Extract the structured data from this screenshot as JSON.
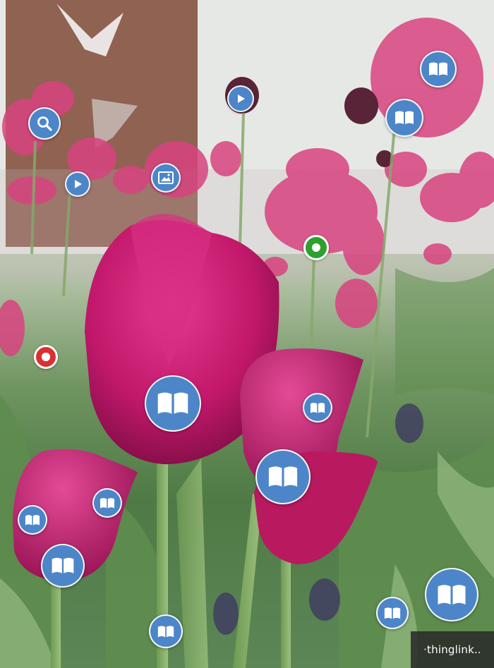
{
  "brand": {
    "label": "·thinglink.."
  },
  "colors": {
    "tag_blue": "#4d86c8",
    "status_green": "#2ea02e",
    "status_red": "#d93030"
  },
  "hotspots": [
    {
      "id": "book-1",
      "icon": "book-icon"
    },
    {
      "id": "book-2",
      "icon": "book-icon"
    },
    {
      "id": "search-1",
      "icon": "magnifier-icon"
    },
    {
      "id": "play-1",
      "icon": "play-icon"
    },
    {
      "id": "play-2",
      "icon": "play-icon"
    },
    {
      "id": "image-1",
      "icon": "image-icon"
    },
    {
      "id": "green-dot",
      "icon": "dot-icon"
    },
    {
      "id": "red-dot",
      "icon": "dot-icon"
    },
    {
      "id": "book-3",
      "icon": "book-icon"
    },
    {
      "id": "book-4",
      "icon": "book-icon"
    },
    {
      "id": "book-5",
      "icon": "book-icon"
    },
    {
      "id": "book-6",
      "icon": "book-icon"
    },
    {
      "id": "book-7",
      "icon": "book-icon"
    },
    {
      "id": "book-8",
      "icon": "book-icon"
    },
    {
      "id": "book-9",
      "icon": "book-icon"
    },
    {
      "id": "book-10",
      "icon": "book-icon"
    },
    {
      "id": "book-11",
      "icon": "book-icon"
    }
  ]
}
